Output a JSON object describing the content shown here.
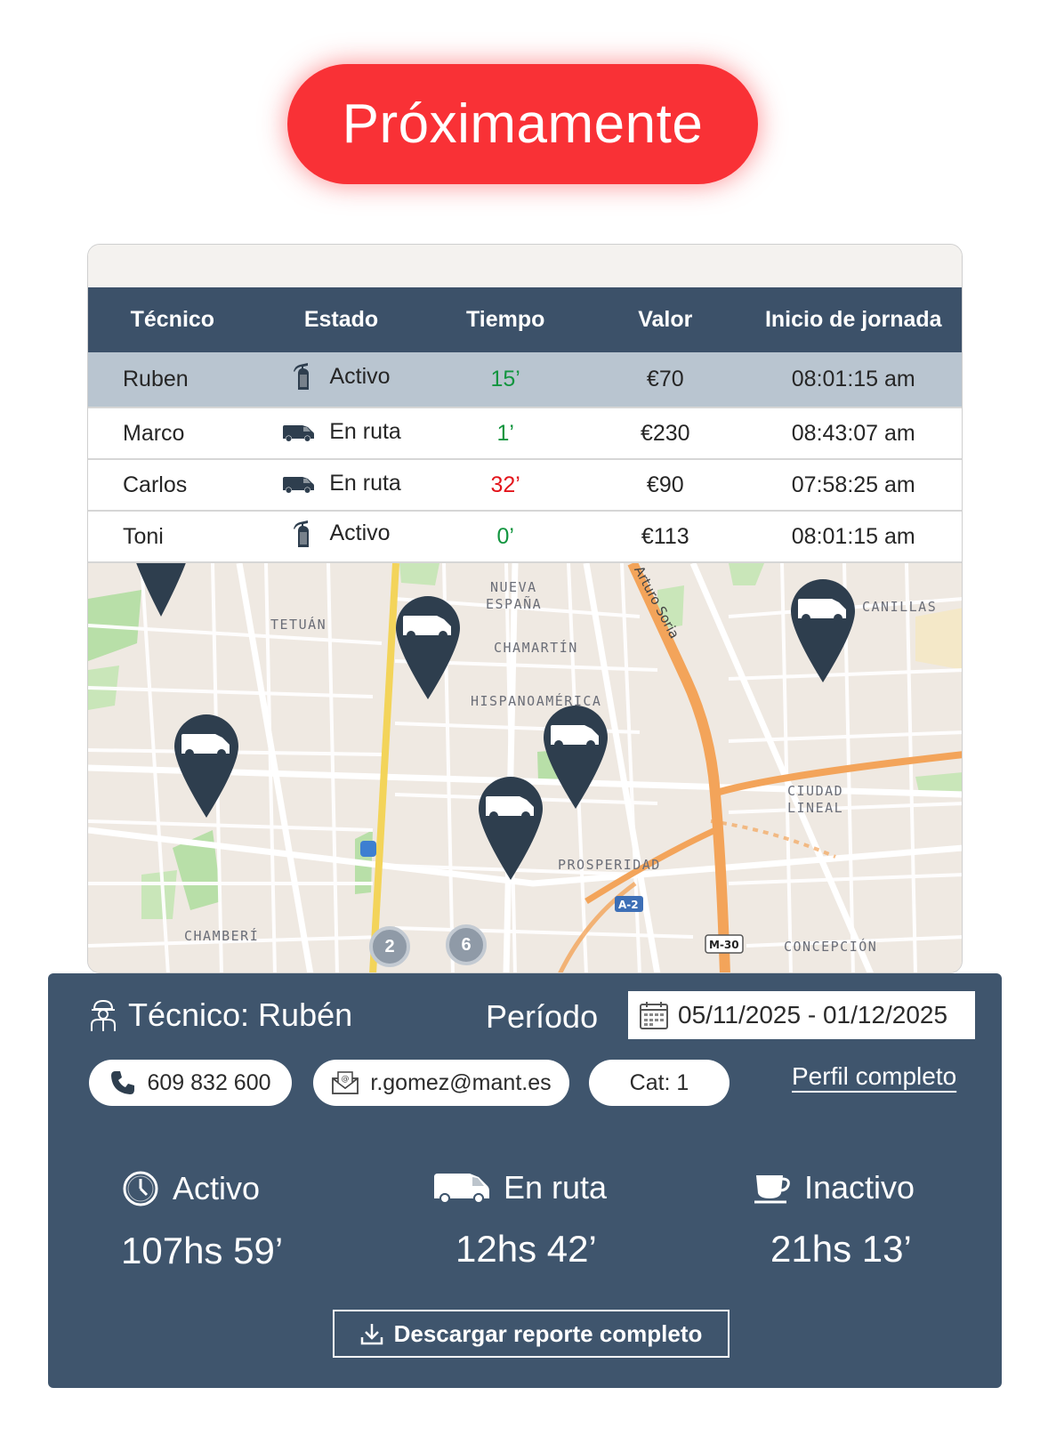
{
  "badge": {
    "label": "Próximamente"
  },
  "table": {
    "headers": [
      "Técnico",
      "Estado",
      "Tiempo",
      "Valor",
      "Inicio de jornada"
    ],
    "rows": [
      {
        "name": "Ruben",
        "status_icon": "extinguisher-icon",
        "status": "Activo",
        "time": "15’",
        "time_color": "#12953f",
        "value": "€70",
        "start": "08:01:15 am",
        "selected": true
      },
      {
        "name": "Marco",
        "status_icon": "van-icon",
        "status": "En ruta",
        "time": "1’",
        "time_color": "#12953f",
        "value": "€230",
        "start": "08:43:07 am",
        "selected": false
      },
      {
        "name": "Carlos",
        "status_icon": "van-icon",
        "status": "En ruta",
        "time": "32’",
        "time_color": "#e3141b",
        "value": "€90",
        "start": "07:58:25 am",
        "selected": false
      },
      {
        "name": "Toni",
        "status_icon": "extinguisher-icon",
        "status": "Activo",
        "time": "0’",
        "time_color": "#12953f",
        "value": "€113",
        "start": "08:01:15 am",
        "selected": false
      }
    ]
  },
  "map": {
    "labels": {
      "tetuan": "TETUÁN",
      "nueva_espana_1": "NUEVA",
      "nueva_espana_2": "ESPAÑA",
      "chamartin": "CHAMARTÍN",
      "hispanoamerica": "HISPANOAMÉRICA",
      "canillas": "CANILLAS",
      "ciudad_lineal_1": "CIUDAD",
      "ciudad_lineal_2": "LINEAL",
      "prosperidad": "PROSPERIDAD",
      "chamberi": "CHAMBERÍ",
      "concepcion": "CONCEPCIÓN",
      "arturo_soria": "Arturo Soria",
      "a2": "A-2",
      "m30": "M-30"
    },
    "clusters": [
      "2",
      "6"
    ]
  },
  "panel": {
    "technician": "Técnico: Rubén",
    "period_label": "Período",
    "period_value": "05/11/2025 - 01/12/2025",
    "phone": "609 832 600",
    "email": "r.gomez@mant.es",
    "category": "Cat: 1",
    "profile_link": "Perfil completo",
    "stats": [
      {
        "label": "Activo",
        "icon": "clock-icon",
        "value": "107hs 59’"
      },
      {
        "label": "En ruta",
        "icon": "van-icon",
        "value": "12hs 42’"
      },
      {
        "label": "Inactivo",
        "icon": "coffee-cup-icon",
        "value": "21hs 13’"
      }
    ],
    "download_label": "Descargar reporte completo"
  },
  "colors": {
    "brand_red": "#f93136",
    "header_blue": "#3c5169",
    "panel_blue": "#3f556d",
    "selected_row": "#b9c5d0",
    "pin": "#2e3e4e"
  }
}
